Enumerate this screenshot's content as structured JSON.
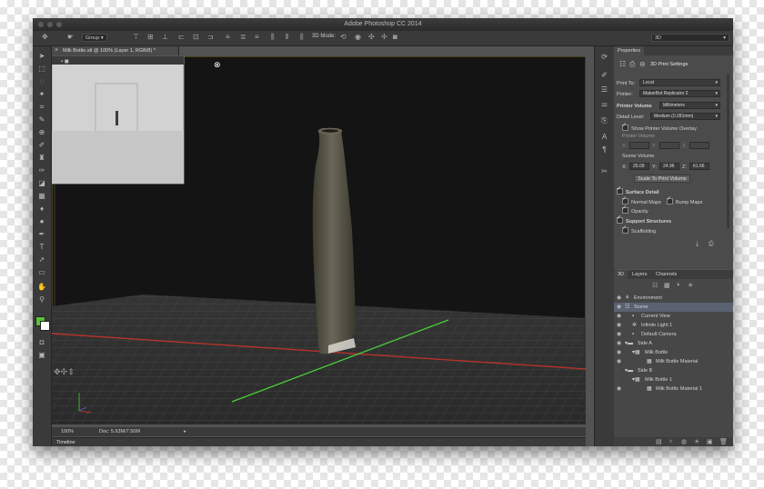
{
  "app": {
    "title": "Adobe Photoshop CC 2014"
  },
  "options_bar": {
    "group_label": "Group",
    "mode_label": "3D Mode:",
    "workspace": "3D"
  },
  "document": {
    "tab_title": "Milk Bottle.stl @ 100% (Layer 1, RGB/8) *",
    "zoom": "100%",
    "doc_info": "Doc: 5.93M/7.50M"
  },
  "timeline_label": "Timeline",
  "properties": {
    "tab_label": "Properties",
    "header": "3D Print Settings",
    "print_to_label": "Print To:",
    "print_to_value": "Local",
    "printer_label": "Printer:",
    "printer_value": "MakerBot Replicator 2",
    "printer_volume_label": "Printer Volume",
    "printer_volume_unit": "Millimeters",
    "detail_level_label": "Detail Level:",
    "detail_level_value": "Medium (0.281mm)",
    "show_overlay_label": "Show Printer Volume Overlay",
    "printer_volume_sub": "Printer Volume",
    "scene_volume_label": "Scene Volume",
    "x_label": "X:",
    "x_value": "25.09",
    "y_label": "Y:",
    "y_value": "24.96",
    "z_label": "Z:",
    "z_value": "61.66",
    "scale_button": "Scale To Print Volume",
    "surface_detail_label": "Surface Detail",
    "normal_maps_label": "Normal Maps",
    "bump_maps_label": "Bump Maps",
    "opacity_label": "Opacity",
    "support_structures_label": "Support Structures",
    "scaffolding_label": "Scaffolding"
  },
  "layers_panel": {
    "tabs": [
      "3D",
      "Layers",
      "Channels"
    ],
    "items": [
      {
        "label": "Environment"
      },
      {
        "label": "Scene"
      },
      {
        "label": "Current View"
      },
      {
        "label": "Infinite Light 1"
      },
      {
        "label": "Default Camera"
      },
      {
        "label": "Side A"
      },
      {
        "label": "Milk Bottle"
      },
      {
        "label": "Milk Bottle Material"
      },
      {
        "label": "Side B"
      },
      {
        "label": "Milk Bottle 1"
      },
      {
        "label": "Milk Bottle Material 1"
      }
    ]
  },
  "colors": {
    "accent_green": "#5bc236",
    "accent_red": "#d8342c",
    "selection": "#5a6272"
  }
}
